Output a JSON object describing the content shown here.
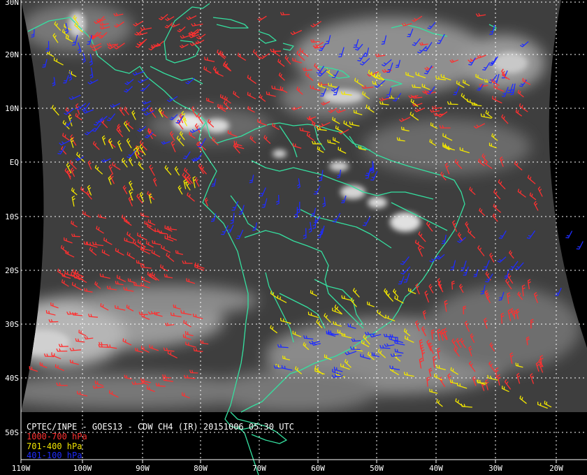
{
  "caption": {
    "title": "CPTEC/INPE - GOES13 - CDW CH4 (IR) 20151006 05:30 UTC"
  },
  "legend": [
    {
      "label": "1000-700 hPa",
      "color": "#ff3030"
    },
    {
      "label": "701-400 hPa",
      "color": "#f2e600"
    },
    {
      "label": "401-100 hPa",
      "color": "#1f2cff"
    }
  ],
  "colors": {
    "coastline": "#35e0a0",
    "grid": "#ffffff",
    "background": "#000000"
  },
  "grid": {
    "latitude_labels": [
      "30N",
      "20N",
      "10N",
      "EQ",
      "10S",
      "20S",
      "30S",
      "40S",
      "50S"
    ],
    "longitude_labels": [
      "110W",
      "100W",
      "90W",
      "80W",
      "70W",
      "60W",
      "50W",
      "40W",
      "30W",
      "20W"
    ]
  }
}
